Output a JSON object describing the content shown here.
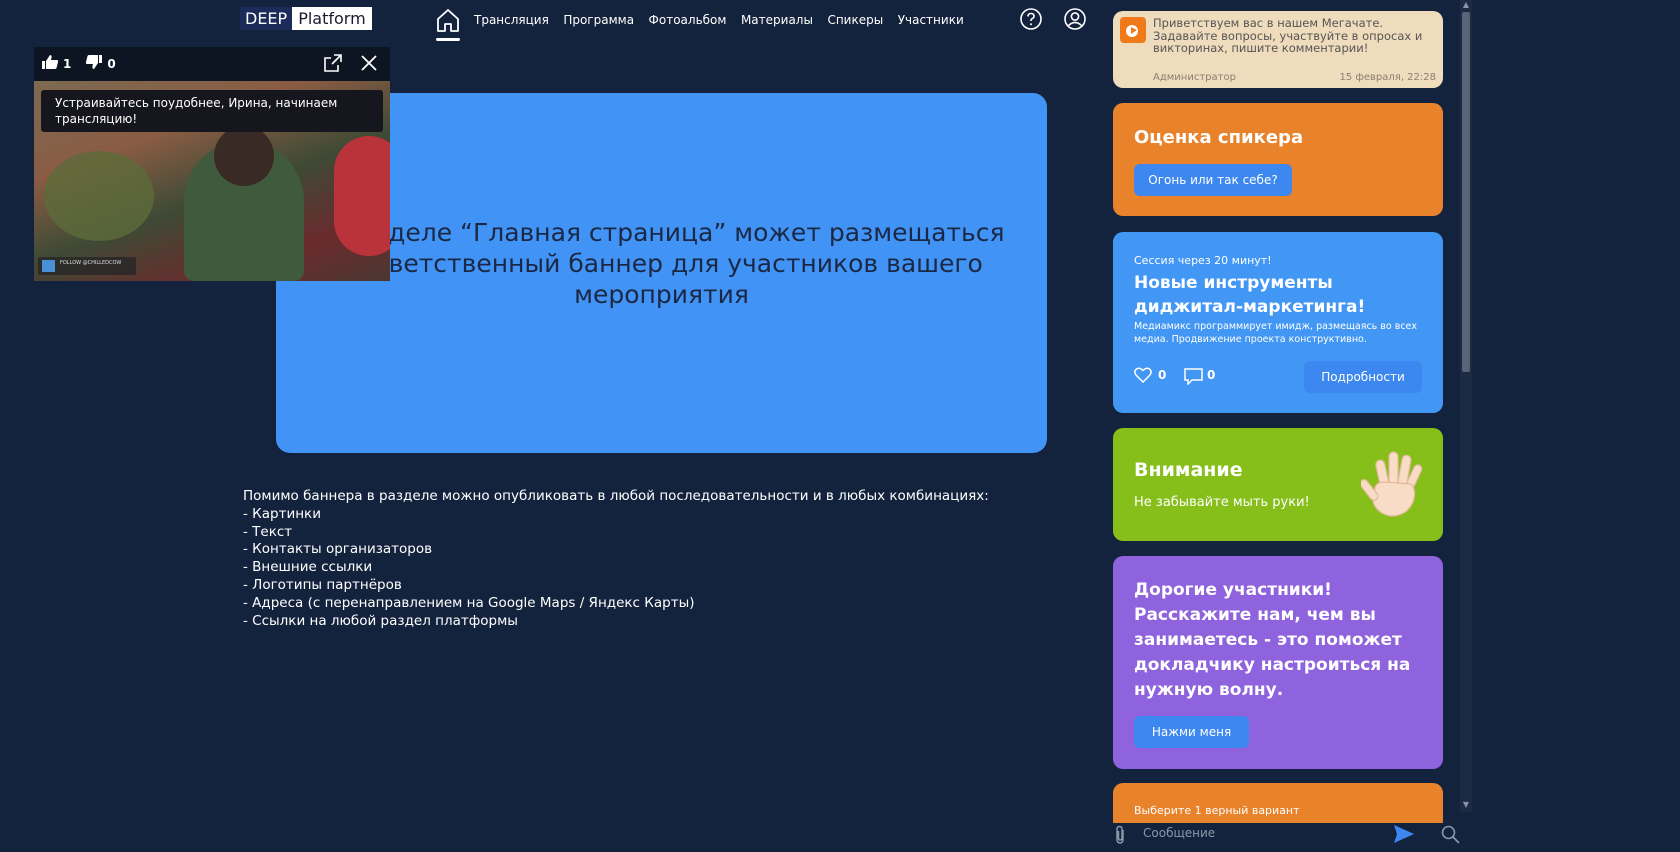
{
  "header": {
    "logo": {
      "left": "DEEP",
      "right": "Platform"
    },
    "nav": [
      "Трансляция",
      "Программа",
      "Фотоальбом",
      "Материалы",
      "Спикеры",
      "Участники"
    ]
  },
  "video": {
    "likes": "1",
    "dislikes": "0",
    "toast": "Устраивайтесь поудобнее, Ирина, начинаем трансляцию!",
    "overlay_text": "FOLLOW @CHILLEDCOW"
  },
  "main": {
    "banner_text": "В разделе “Главная страница” может размещаться приветственный баннер для участников вашего мероприятия",
    "intro": "Помимо баннера в разделе можно опубликовать в любой последовательности и в любых комбинациях:",
    "list": [
      "- Картинки",
      "- Текст",
      "- Контакты организаторов",
      "- Внешние ссылки",
      "- Логотипы партнёров",
      "- Адреса (с перенаправлением на Google Maps / Яндекс Карты)",
      "- Ссылки на любой раздел платформы"
    ]
  },
  "chat": {
    "admin_message": "Приветствуем вас в нашем Мегачате. Задавайте вопросы, участвуйте в опросах и викторинах, пишите комментарии!",
    "admin_name": "Администратор",
    "admin_time": "15 февраля, 22:28",
    "placeholder": "Сообщение"
  },
  "cards": {
    "speaker": {
      "title": "Оценка спикера",
      "button": "Огонь или так себе?"
    },
    "session": {
      "pre": "Сессия через 20 минут!",
      "title": "Новые инструменты диджитал-маркетинга!",
      "desc": "Медиамикс программирует имидж, размещаясь во всех медиа. Продвижение проекта конструктивно.",
      "likes": "0",
      "comments": "0",
      "button": "Подробности"
    },
    "attention": {
      "title": "Внимание",
      "text": "Не забывайте мыть руки!"
    },
    "participants": {
      "title": "Дорогие участники! Расскажите нам, чем вы занимаетесь - это поможет докладчику настроиться на нужную волну.",
      "button": "Нажми меня"
    },
    "last": {
      "text": "Выберите 1 верный вариант"
    }
  },
  "colors": {
    "background": "#14233d",
    "banner": "#4194f5",
    "orange": "#e8822b",
    "blue": "#4397f4",
    "green": "#86be1a",
    "purple": "#8e63dd",
    "admin": "#efdcbc"
  }
}
